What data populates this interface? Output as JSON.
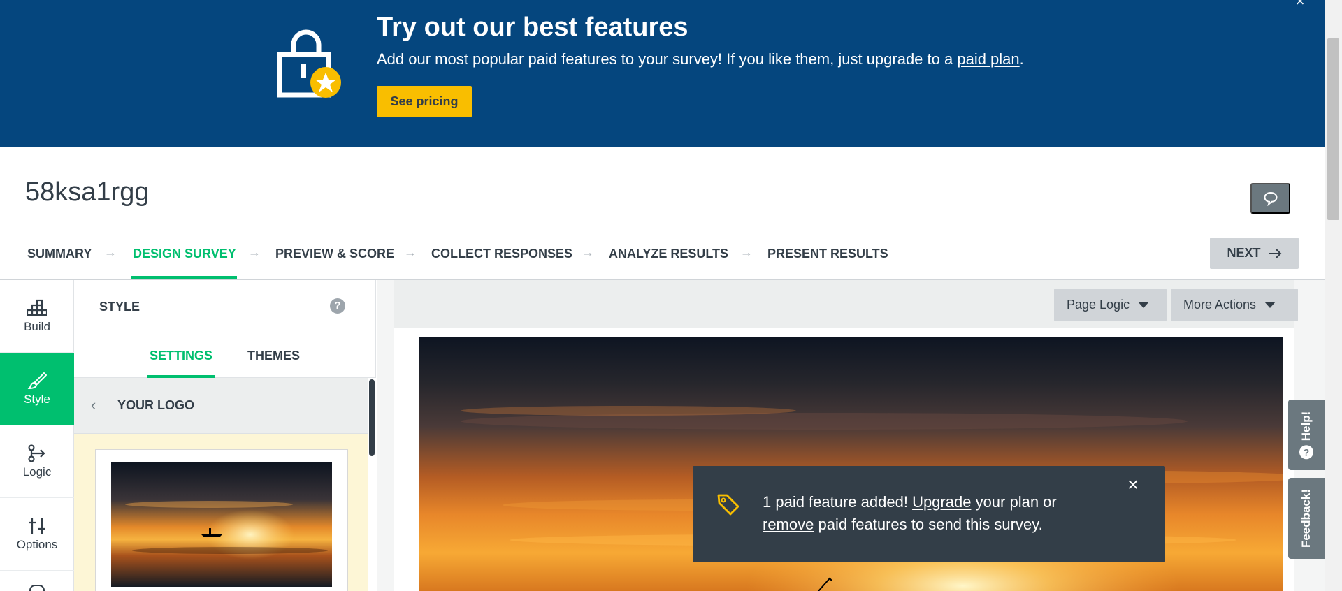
{
  "banner": {
    "title": "Try out our best features",
    "text": "Add our most popular paid features to your survey! If you like them, just upgrade to a ",
    "link": "paid plan",
    "text_end": ".",
    "button": "See pricing",
    "close_glyph": "×"
  },
  "survey": {
    "title": "58ksa1rgg"
  },
  "steps": {
    "items": [
      {
        "label": "SUMMARY"
      },
      {
        "label": "DESIGN SURVEY"
      },
      {
        "label": "PREVIEW & SCORE"
      },
      {
        "label": "COLLECT RESPONSES"
      },
      {
        "label": "ANALYZE RESULTS"
      },
      {
        "label": "PRESENT RESULTS"
      }
    ],
    "active": "DESIGN SURVEY",
    "next": "NEXT"
  },
  "rail": {
    "items": [
      {
        "label": "Build",
        "icon": "build-icon"
      },
      {
        "label": "Style",
        "icon": "paintbrush-icon"
      },
      {
        "label": "Logic",
        "icon": "logic-icon"
      },
      {
        "label": "Options",
        "icon": "sliders-icon"
      }
    ],
    "active": "Style"
  },
  "panel": {
    "title": "STYLE",
    "help": "?",
    "tabs": [
      {
        "label": "SETTINGS"
      },
      {
        "label": "THEMES"
      }
    ],
    "active_tab": "SETTINGS",
    "back_label": "YOUR LOGO"
  },
  "canvas": {
    "page_logic": "Page Logic",
    "more_actions": "More Actions"
  },
  "toast": {
    "line1_a": "1 paid feature added! ",
    "upgrade": "Upgrade",
    "line1_b": " your plan or",
    "remove": "remove",
    "line2": " paid features to send this survey."
  },
  "side_tabs": {
    "help": "Help!",
    "feedback": "Feedback!"
  },
  "colors": {
    "banner": "#05467e",
    "accent": "#00bf6f",
    "cta": "#f9be00",
    "dark": "#333e48"
  }
}
